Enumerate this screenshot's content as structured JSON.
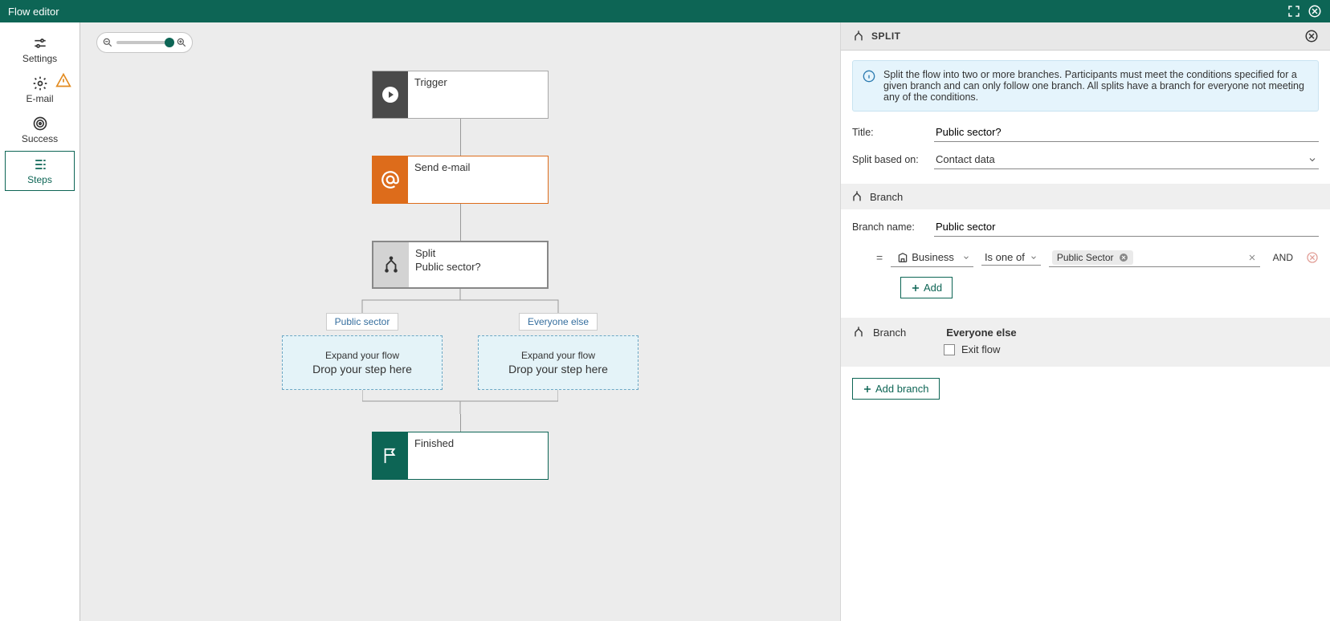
{
  "header": {
    "title": "Flow editor"
  },
  "sidebar": {
    "items": [
      {
        "label": "Settings"
      },
      {
        "label": "E-mail"
      },
      {
        "label": "Success"
      },
      {
        "label": "Steps"
      }
    ]
  },
  "nodes": {
    "trigger": {
      "title": "Trigger"
    },
    "email": {
      "title": "Send e-mail"
    },
    "split": {
      "title": "Split",
      "sub": "Public sector?"
    },
    "finished": {
      "title": "Finished"
    }
  },
  "branches": {
    "labels": [
      "Public sector",
      "Everyone else"
    ]
  },
  "dropzone": {
    "line1": "Expand your flow",
    "line2": "Drop your step here"
  },
  "panel": {
    "title": "SPLIT",
    "info": "Split the flow into two or more branches. Participants must meet the conditions specified for a given branch and can only follow one branch. All splits have a branch for everyone not meeting any of the conditions.",
    "fields": {
      "title_label": "Title:",
      "title_value": "Public sector?",
      "split_based_label": "Split based on:",
      "split_based_value": "Contact data"
    },
    "branch_section": {
      "header": "Branch",
      "name_label": "Branch name:",
      "name_value": "Public sector"
    },
    "condition": {
      "field": "Business",
      "operator": "Is one of",
      "chips": [
        "Public Sector"
      ],
      "logical": "AND"
    },
    "buttons": {
      "add": "Add",
      "add_branch": "Add branch"
    },
    "everyone": {
      "header": "Branch",
      "title": "Everyone else",
      "exit_label": "Exit flow"
    }
  }
}
